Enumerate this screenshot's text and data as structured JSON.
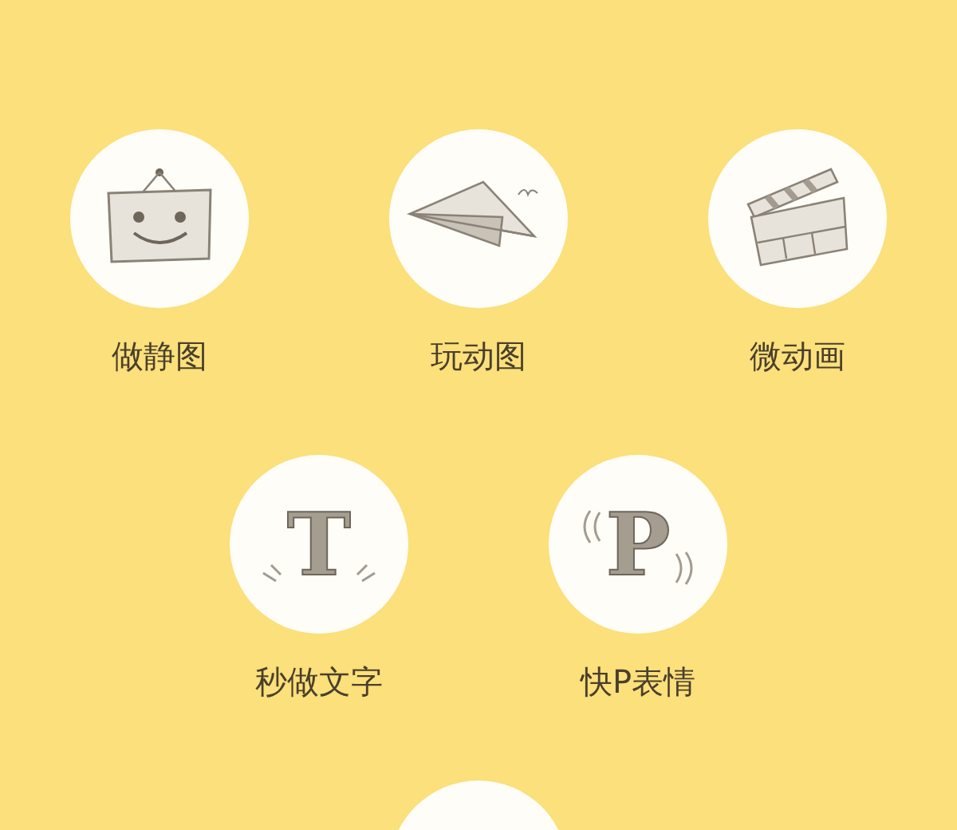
{
  "rows": [
    {
      "items": [
        {
          "label": "做静图",
          "kind": "sign"
        },
        {
          "label": "玩动图",
          "kind": "plane"
        },
        {
          "label": "微动画",
          "kind": "clapboard"
        }
      ]
    },
    {
      "items": [
        {
          "label": "秒做文字",
          "kind": "glyph",
          "glyph": "T"
        },
        {
          "label": "快P表情",
          "kind": "glyph",
          "glyph": "P"
        }
      ]
    },
    {
      "items": [
        {
          "kind": "blank"
        }
      ]
    }
  ]
}
